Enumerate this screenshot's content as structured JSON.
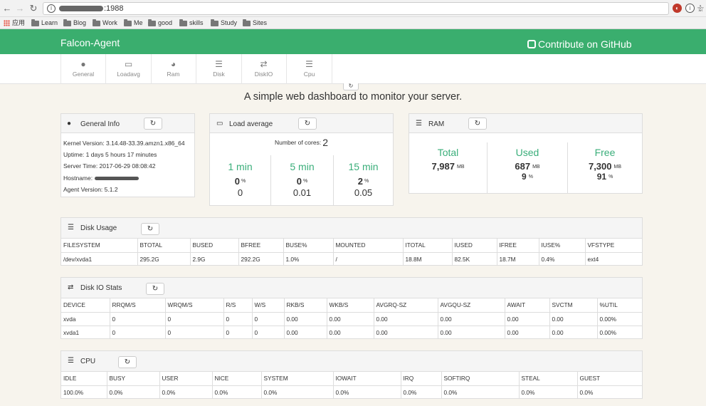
{
  "browser": {
    "url_suffix": ":1988",
    "bookmarks": [
      "应用",
      "Learn",
      "Blog",
      "Work",
      "Me",
      "good",
      "skills",
      "Study",
      "Sites"
    ]
  },
  "header": {
    "brand": "Falcon-Agent",
    "github_link": "Contribute on GitHub"
  },
  "tabs": [
    {
      "label": "General",
      "icon": "info-icon"
    },
    {
      "label": "Loadavg",
      "icon": "laptop-icon"
    },
    {
      "label": "Ram",
      "icon": "dashboard-icon"
    },
    {
      "label": "Disk",
      "icon": "list-icon"
    },
    {
      "label": "DiskIO",
      "icon": "exchange-icon"
    },
    {
      "label": "Cpu",
      "icon": "list-icon"
    }
  ],
  "subtitle": "A simple web dashboard to monitor your server.",
  "general": {
    "title": "General Info",
    "kernel": "Kernel Version: 3.14.48-33.39.amzn1.x86_64",
    "uptime": "Uptime: 1 days 5 hours 17 minutes",
    "server_time": "Server Time: 2017-06-29 08:08:42",
    "hostname_label": "Hostname:",
    "agent": "Agent Version: 5.1.2"
  },
  "load": {
    "title": "Load average",
    "cores_label": "Number of cores:",
    "cores": "2",
    "items": [
      {
        "label": "1 min",
        "pct": "0",
        "value": "0"
      },
      {
        "label": "5 min",
        "pct": "0",
        "value": "0.01"
      },
      {
        "label": "15 min",
        "pct": "2",
        "value": "0.05"
      }
    ],
    "pct_unit": "%"
  },
  "ram": {
    "title": "RAM",
    "unit": "MB",
    "pct_unit": "%",
    "items": [
      {
        "label": "Total",
        "value": "7,987",
        "pct": ""
      },
      {
        "label": "Used",
        "value": "687",
        "pct": "9"
      },
      {
        "label": "Free",
        "value": "7,300",
        "pct": "91"
      }
    ]
  },
  "disk_usage": {
    "title": "Disk Usage",
    "columns": [
      "FILESYSTEM",
      "BTOTAL",
      "BUSED",
      "BFREE",
      "BUSE%",
      "MOUNTED",
      "ITOTAL",
      "IUSED",
      "IFREE",
      "IUSE%",
      "VFSTYPE"
    ],
    "rows": [
      [
        "/dev/xvda1",
        "295.2G",
        "2.9G",
        "292.2G",
        "1.0%",
        "/",
        "18.8M",
        "82.5K",
        "18.7M",
        "0.4%",
        "ext4"
      ]
    ]
  },
  "disk_io": {
    "title": "Disk IO Stats",
    "columns": [
      "DEVICE",
      "RRQM/S",
      "WRQM/S",
      "R/S",
      "W/S",
      "RKB/S",
      "WKB/S",
      "AVGRQ-SZ",
      "AVGQU-SZ",
      "AWAIT",
      "SVCTM",
      "%UTIL"
    ],
    "rows": [
      [
        "xvda",
        "0",
        "0",
        "0",
        "0",
        "0.00",
        "0.00",
        "0.00",
        "0.00",
        "0.00",
        "0.00",
        "0.00%"
      ],
      [
        "xvda1",
        "0",
        "0",
        "0",
        "0",
        "0.00",
        "0.00",
        "0.00",
        "0.00",
        "0.00",
        "0.00",
        "0.00%"
      ]
    ]
  },
  "cpu": {
    "title": "CPU",
    "columns": [
      "IDLE",
      "BUSY",
      "USER",
      "NICE",
      "SYSTEM",
      "IOWAIT",
      "IRQ",
      "SOFTIRQ",
      "STEAL",
      "GUEST"
    ],
    "rows": [
      [
        "100.0%",
        "0.0%",
        "0.0%",
        "0.0%",
        "0.0%",
        "0.0%",
        "0.0%",
        "0.0%",
        "0.0%",
        "0.0%"
      ]
    ]
  },
  "colors": {
    "brand_green": "#3aae6e",
    "accent_label": "#3aae7a",
    "page_bg": "#f7f4ed"
  }
}
